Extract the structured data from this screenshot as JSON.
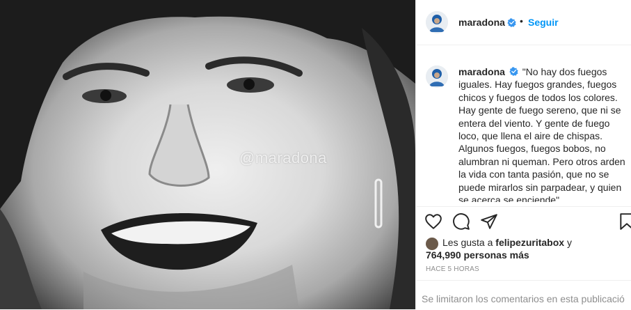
{
  "post": {
    "watermark": "@maradona",
    "photo_description_icon": "portrait-photo"
  },
  "header": {
    "username": "maradona",
    "separator": "•",
    "follow_label": "Seguir"
  },
  "caption": {
    "username": "maradona",
    "text": "\"No hay dos fuegos iguales. Hay fuegos grandes, fuegos chicos y fuegos de todos los colores. Hay gente de fuego sereno, que ni se entera del viento. Y gente de fuego loco, que llena el aire de chispas. Algunos fuegos, fuegos bobos, no alumbran ni queman. Pero otros arden la vida con tanta pasión, que no se puede mirarlos sin parpadear, y quien se acerca se enciende\""
  },
  "actions": {
    "icons": [
      "heart-icon",
      "comment-icon",
      "share-icon",
      "bookmark-icon"
    ]
  },
  "likes": {
    "prefix": "Les gusta a",
    "liker": "felipezuritabox",
    "conjunction": "y",
    "count": "764,990 personas más"
  },
  "timestamp": "HACE 5 HORAS",
  "comments_notice": "Se limitaron los comentarios en esta publicació",
  "colors": {
    "accent": "#0095f6",
    "text": "#262626",
    "muted": "#8e8e8e",
    "border": "#efefef"
  }
}
